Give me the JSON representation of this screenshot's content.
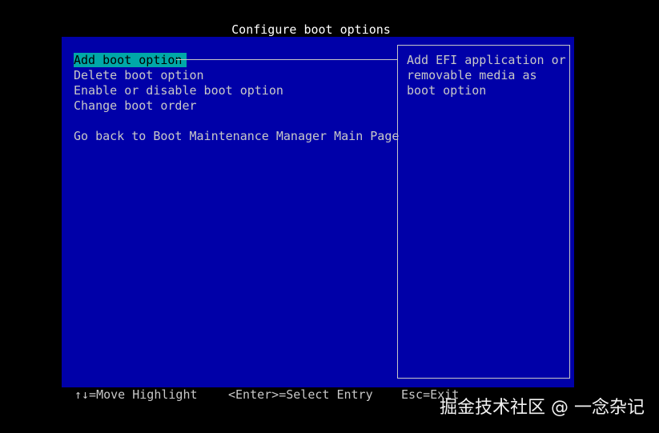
{
  "title": "Configure boot options",
  "menu": {
    "items": [
      {
        "label": "Add boot option"
      },
      {
        "label": "Delete boot option"
      },
      {
        "label": "Enable or disable boot option"
      },
      {
        "label": "Change boot order"
      },
      {
        "label": "Go back to Boot Maintenance Manager Main Page"
      }
    ],
    "selected_index": 0
  },
  "help": {
    "lines": [
      "Add EFI application or",
      "removable media as",
      "boot option"
    ]
  },
  "status": {
    "move": "↑↓=Move Highlight",
    "enter": "<Enter>=Select Entry",
    "esc": "Esc=Exit"
  },
  "watermark": "掘金技术社区 @ 一念杂记",
  "colors": {
    "background": "#000000",
    "panel": "#0000a8",
    "highlight": "#00a8a8",
    "text": "#c8c8c8"
  }
}
